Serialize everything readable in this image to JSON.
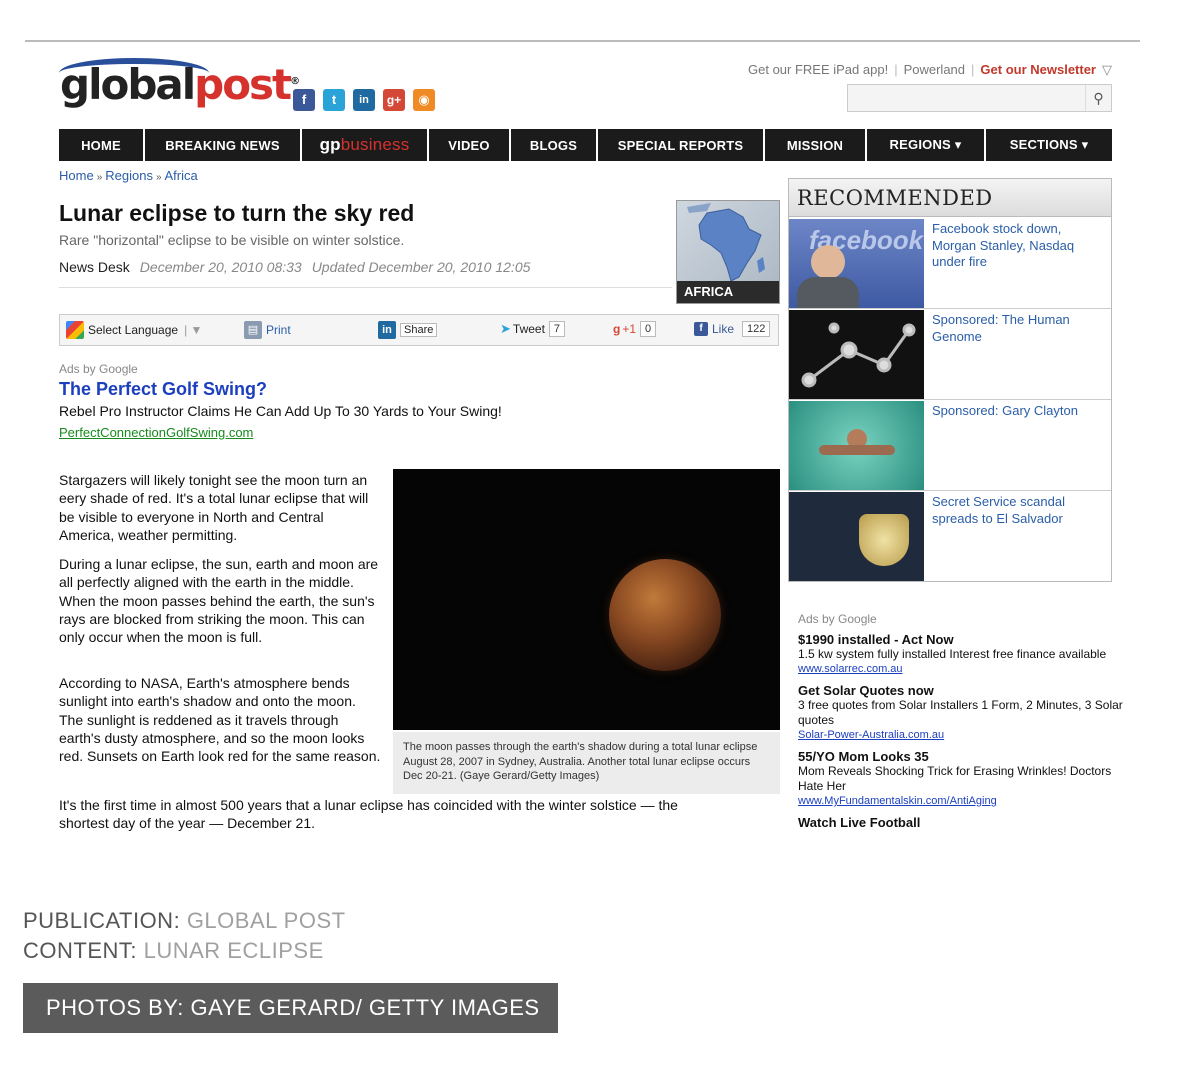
{
  "header": {
    "logo_left": "global",
    "logo_right": "post",
    "logo_mark": "®",
    "social": [
      {
        "icon": "facebook-icon",
        "glyph": "f",
        "color": "#3b5998"
      },
      {
        "icon": "twitter-icon",
        "glyph": "t",
        "color": "#2aa3d8"
      },
      {
        "icon": "linkedin-icon",
        "glyph": "in",
        "color": "#1f6aa0"
      },
      {
        "icon": "google-plus-icon",
        "glyph": "g+",
        "color": "#d34836"
      },
      {
        "icon": "rss-icon",
        "glyph": "◉",
        "color": "#f08a24"
      }
    ],
    "top_links": [
      "Get our FREE iPad app!",
      "Powerland",
      "Get our Newsletter"
    ],
    "search_icon": "search-icon"
  },
  "nav": {
    "items": [
      "HOME",
      "BREAKING NEWS",
      "",
      "VIDEO",
      "BLOGS",
      "SPECIAL REPORTS",
      "MISSION",
      "REGIONS ▾",
      "SECTIONS ▾"
    ],
    "gp_left": "gp",
    "gp_right": "business"
  },
  "breadcrumb": [
    "Home",
    "Regions",
    "Africa"
  ],
  "breadcrumb_sep": "»",
  "article": {
    "title": "Lunar eclipse to turn the sky red",
    "subtitle": "Rare \"horizontal\" eclipse to be visible on winter solstice.",
    "author": "News Desk",
    "date": "December 20, 2010 08:33",
    "updated": "Updated December 20, 2010 12:05",
    "region_label": "AFRICA",
    "paragraphs": [
      "Stargazers will likely tonight see the moon turn an eery shade of red. It's a total lunar eclipse that will be visible to everyone in North and Central America, weather permitting.",
      "During a lunar eclipse, the sun, earth and moon are all perfectly aligned with the earth in the middle. When the moon passes behind the earth, the sun's rays are blocked from striking the moon. This can only occur when the moon is full.",
      "According to NASA, Earth's atmosphere bends sunlight into earth's shadow and onto the moon. The sunlight is reddened as it travels through earth's dusty atmosphere, and so the moon looks red. Sunsets on Earth look red for the same reason.",
      "It's the first time in almost 500 years that a lunar eclipse has coincided with the winter solstice — the shortest day of the year — December 21."
    ],
    "photo_caption": "The moon passes through the earth's shadow during a total lunar eclipse August 28, 2007 in Sydney, Australia. Another total lunar eclipse occurs Dec 20-21. (Gaye Gerard/Getty Images)"
  },
  "sharebar": {
    "select_language": "Select Language",
    "print": "Print",
    "share": "Share",
    "tweet": "Tweet",
    "tweet_count": "7",
    "plus_one": "+1",
    "plus_count": "0",
    "like": "Like",
    "like_count": "122"
  },
  "ad": {
    "ads_by": "Ads by Google",
    "title": "The Perfect Golf Swing?",
    "text": "Rebel Pro Instructor Claims He Can Add Up To 30 Yards to Your Swing!",
    "url": "PerfectConnectionGolfSwing.com"
  },
  "recommended": {
    "heading": "RECOMMENDED",
    "items": [
      {
        "text": "Facebook stock down, Morgan Stanley, Nasdaq under fire",
        "thumb_text": "facebook"
      },
      {
        "text": "Sponsored: The Human Genome"
      },
      {
        "text": "Sponsored: Gary Clayton"
      },
      {
        "text": "Secret Service scandal spreads to El Salvador"
      }
    ]
  },
  "sidebar_ads": {
    "ads_by": "Ads by Google",
    "items": [
      {
        "title": "$1990 installed - Act Now",
        "text": "1.5 kw system fully installed Interest free finance available",
        "url": "www.solarrec.com.au"
      },
      {
        "title": "Get Solar Quotes now",
        "text": "3 free quotes from Solar Installers 1 Form, 2 Minutes, 3 Solar quotes",
        "url": "Solar-Power-Australia.com.au"
      },
      {
        "title": "55/YO Mom Looks 35",
        "text": "Mom Reveals Shocking Trick for Erasing Wrinkles! Doctors Hate Her",
        "url": "www.MyFundamentalskin.com/AntiAging"
      },
      {
        "title": "Watch Live Football",
        "text": "",
        "url": ""
      }
    ]
  },
  "credits": {
    "publication_label": "PUBLICATION:",
    "publication_value": "GLOBAL POST",
    "content_label": "CONTENT:",
    "content_value": "LUNAR ECLIPSE",
    "photos_by": "PHOTOS BY: GAYE GERARD/ GETTY IMAGES"
  },
  "colors": {
    "brand_red": "#d6322d",
    "brand_blue": "#2a4f9a",
    "link_blue": "#2a5ea8",
    "nav_bg": "#1b1b1b",
    "ad_green": "#178a1e"
  }
}
